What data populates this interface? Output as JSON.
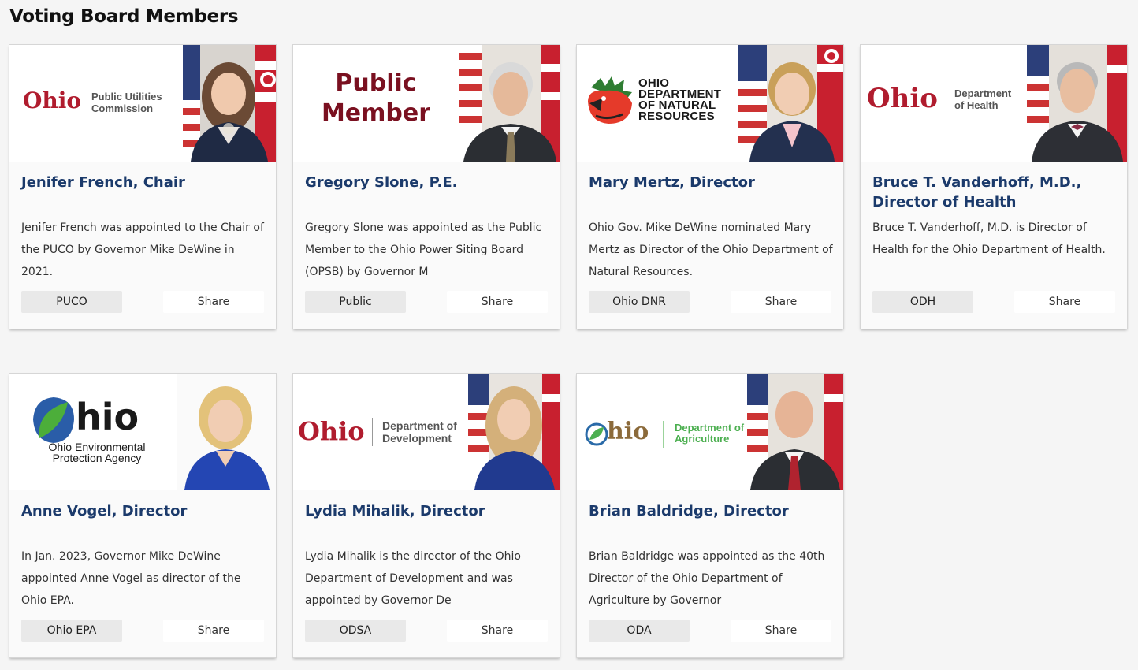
{
  "page": {
    "title": "Voting Board Members"
  },
  "members": [
    {
      "name": "Jenifer French, Chair",
      "bio": "Jenifer French was appointed to the Chair of the PUCO by Governor Mike DeWine in 2021.",
      "tag": "PUCO",
      "share": "Share",
      "logo": {
        "wordmark": "Ohio",
        "line1": "Public Utilities",
        "line2": "Commission"
      }
    },
    {
      "name": "Gregory Slone, P.E.",
      "bio": "Gregory Slone was appointed as the Public Member to the Ohio Power Siting Board (OPSB) by Governor M",
      "tag": "Public",
      "share": "Share",
      "logo": {
        "line1": "Public",
        "line2": "Member"
      }
    },
    {
      "name": "Mary Mertz, Director",
      "bio": "Ohio Gov. Mike DeWine nominated Mary Mertz as Director of the Ohio Department of Natural Resources.",
      "tag": "Ohio DNR",
      "share": "Share",
      "logo": {
        "line1": "OHIO",
        "line2": "DEPARTMENT",
        "line3": "OF NATURAL",
        "line4": "RESOURCES"
      }
    },
    {
      "name": "Bruce T. Vanderhoff, M.D., Director of Health",
      "bio": "Bruce T. Vanderhoff, M.D. is Director of Health for the Ohio Department of Health.",
      "tag": "ODH",
      "share": "Share",
      "logo": {
        "wordmark": "Ohio",
        "line1": "Department",
        "line2": "of Health"
      }
    },
    {
      "name": "Anne Vogel, Director",
      "bio": "In Jan. 2023, Governor Mike DeWine appointed Anne Vogel as director of the Ohio EPA.",
      "tag": "Ohio EPA",
      "share": "Share",
      "logo": {
        "wordmark": "hio",
        "line1": "Ohio Environmental",
        "line2": "Protection Agency"
      }
    },
    {
      "name": "Lydia Mihalik, Director",
      "bio": "Lydia Mihalik is the director of the Ohio Department of Development and was appointed by Governor De",
      "tag": "ODSA",
      "share": "Share",
      "logo": {
        "wordmark": "Ohio",
        "line1": "Department of",
        "line2": "Development"
      }
    },
    {
      "name": "Brian Baldridge, Director",
      "bio": "Brian Baldridge was appointed as the 40th Director of the Ohio Department of Agriculture by Governor",
      "tag": "ODA",
      "share": "Share",
      "logo": {
        "wordmark": "hio",
        "line1": "Department of",
        "line2": "Agriculture"
      }
    }
  ],
  "colors": {
    "name_link": "#1b3a6b",
    "ohio_red": "#b01c2e",
    "public_member_maroon": "#7a1020",
    "epa_green": "#3a9b3a",
    "agriculture_green": "#4caf50"
  },
  "icons": [
    "american-flag",
    "ohio-flag",
    "ohio-dnr-cardinal-icon",
    "ohio-epa-leaf-icon",
    "ohio-agriculture-leaf-icon"
  ]
}
